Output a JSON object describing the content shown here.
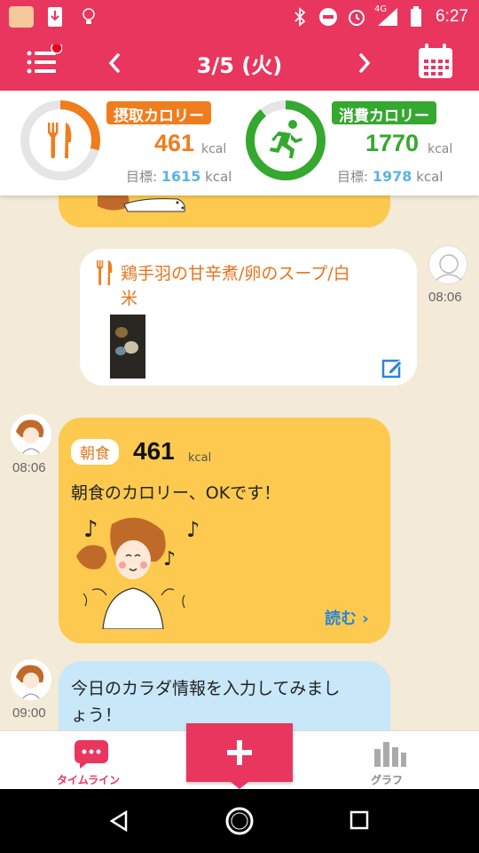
{
  "status_bar": {
    "time": "6:27",
    "network": "4G"
  },
  "header": {
    "date": "3/5 (火)",
    "icons": [
      "menu-icon",
      "chevron-left-icon",
      "chevron-right-icon",
      "calendar-icon"
    ]
  },
  "summary": {
    "intake": {
      "label": "摂取カロリー",
      "value": "461",
      "unit": "kcal",
      "goal_prefix": "目標:",
      "goal_value": "1615",
      "goal_unit": "kcal",
      "progress": 0.29,
      "color": "#f07d1d"
    },
    "burned": {
      "label": "消費カロリー",
      "value": "1770",
      "unit": "kcal",
      "goal_prefix": "目標:",
      "goal_value": "1978",
      "goal_unit": "kcal",
      "progress": 0.89,
      "color": "#35a82f"
    }
  },
  "timeline": {
    "user_post": {
      "meal_text_line1": "鶏手羽の甘辛煮/卵のスープ/白",
      "meal_text_line2": "米",
      "time": "08:06"
    },
    "advice1": {
      "time": "08:06",
      "meal_type": "朝食",
      "calories": "461",
      "unit": "kcal",
      "message": "朝食のカロリー、OKです！",
      "read_more": "読む"
    },
    "advice2": {
      "time": "09:00",
      "message_line1": "今日のカラダ情報を入力してみまし",
      "message_line2": "ょう！"
    }
  },
  "bottom_nav": {
    "timeline_label": "タイムライン",
    "graph_label": "グラフ",
    "add_icon": "plus-icon"
  }
}
